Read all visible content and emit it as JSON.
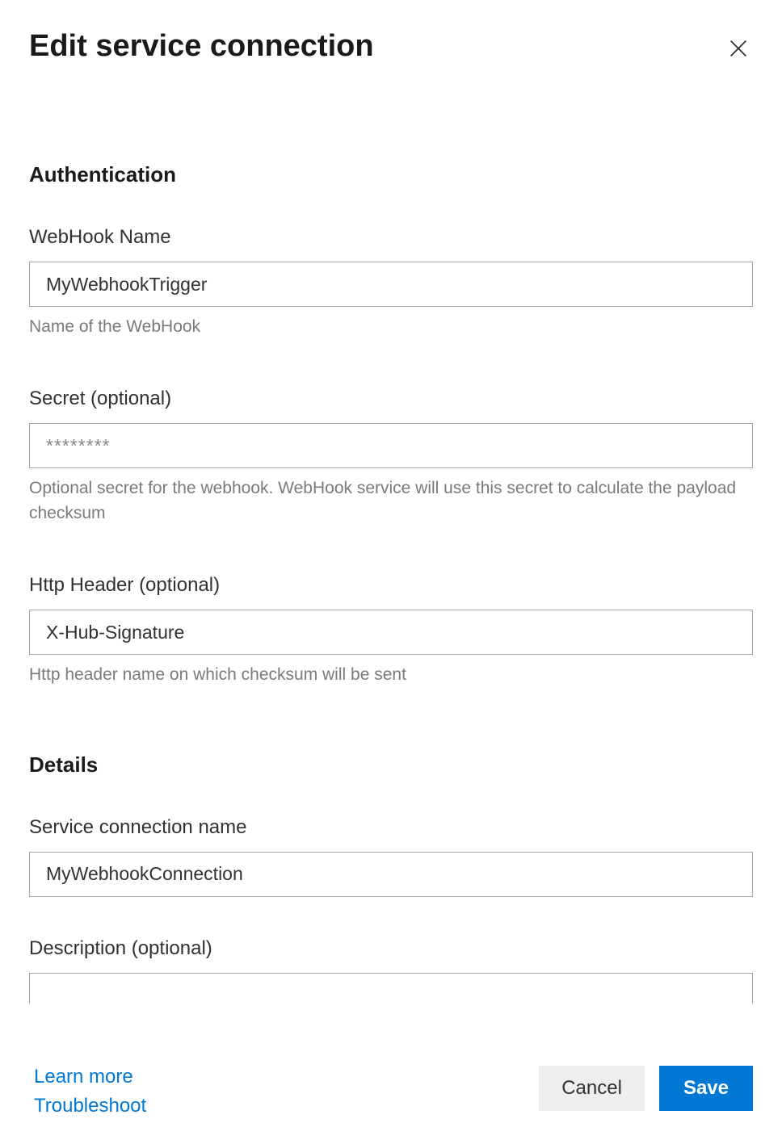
{
  "header": {
    "title": "Edit service connection"
  },
  "sections": {
    "authentication": {
      "heading": "Authentication",
      "webhookName": {
        "label": "WebHook Name",
        "value": "MyWebhookTrigger",
        "help": "Name of the WebHook"
      },
      "secret": {
        "label": "Secret (optional)",
        "value": "",
        "placeholder": "********",
        "help": "Optional secret for the webhook. WebHook service will use this secret to calculate the payload checksum"
      },
      "httpHeader": {
        "label": "Http Header (optional)",
        "value": "X-Hub-Signature",
        "help": "Http header name on which checksum will be sent"
      }
    },
    "details": {
      "heading": "Details",
      "connectionName": {
        "label": "Service connection name",
        "value": "MyWebhookConnection"
      },
      "description": {
        "label": "Description (optional)",
        "value": ""
      }
    }
  },
  "footer": {
    "learnMore": "Learn more",
    "troubleshoot": "Troubleshoot",
    "cancel": "Cancel",
    "save": "Save"
  }
}
